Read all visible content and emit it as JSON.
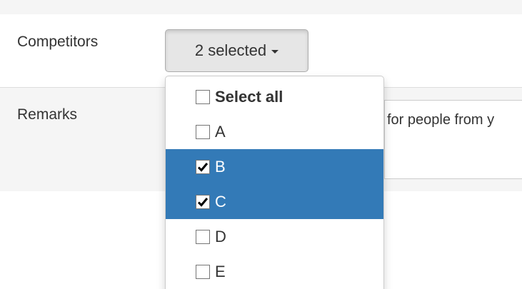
{
  "form": {
    "competitors_label": "Competitors",
    "remarks_label": "Remarks",
    "dropdown_button_text": "2 selected",
    "remarks_value": "for people from y"
  },
  "menu": {
    "items": [
      {
        "label": "Select all",
        "checked": false,
        "highlighted": false,
        "bold": true
      },
      {
        "label": "A",
        "checked": false,
        "highlighted": false,
        "bold": false
      },
      {
        "label": "B",
        "checked": true,
        "highlighted": true,
        "bold": false
      },
      {
        "label": "C",
        "checked": true,
        "highlighted": true,
        "bold": false
      },
      {
        "label": "D",
        "checked": false,
        "highlighted": false,
        "bold": false
      },
      {
        "label": "E",
        "checked": false,
        "highlighted": false,
        "bold": false
      }
    ]
  },
  "colors": {
    "highlight": "#337ab7",
    "row_background": "#f5f5f5",
    "text": "#333333"
  },
  "icons": {
    "caret": "caret-down-icon",
    "check": "checkmark-icon"
  }
}
